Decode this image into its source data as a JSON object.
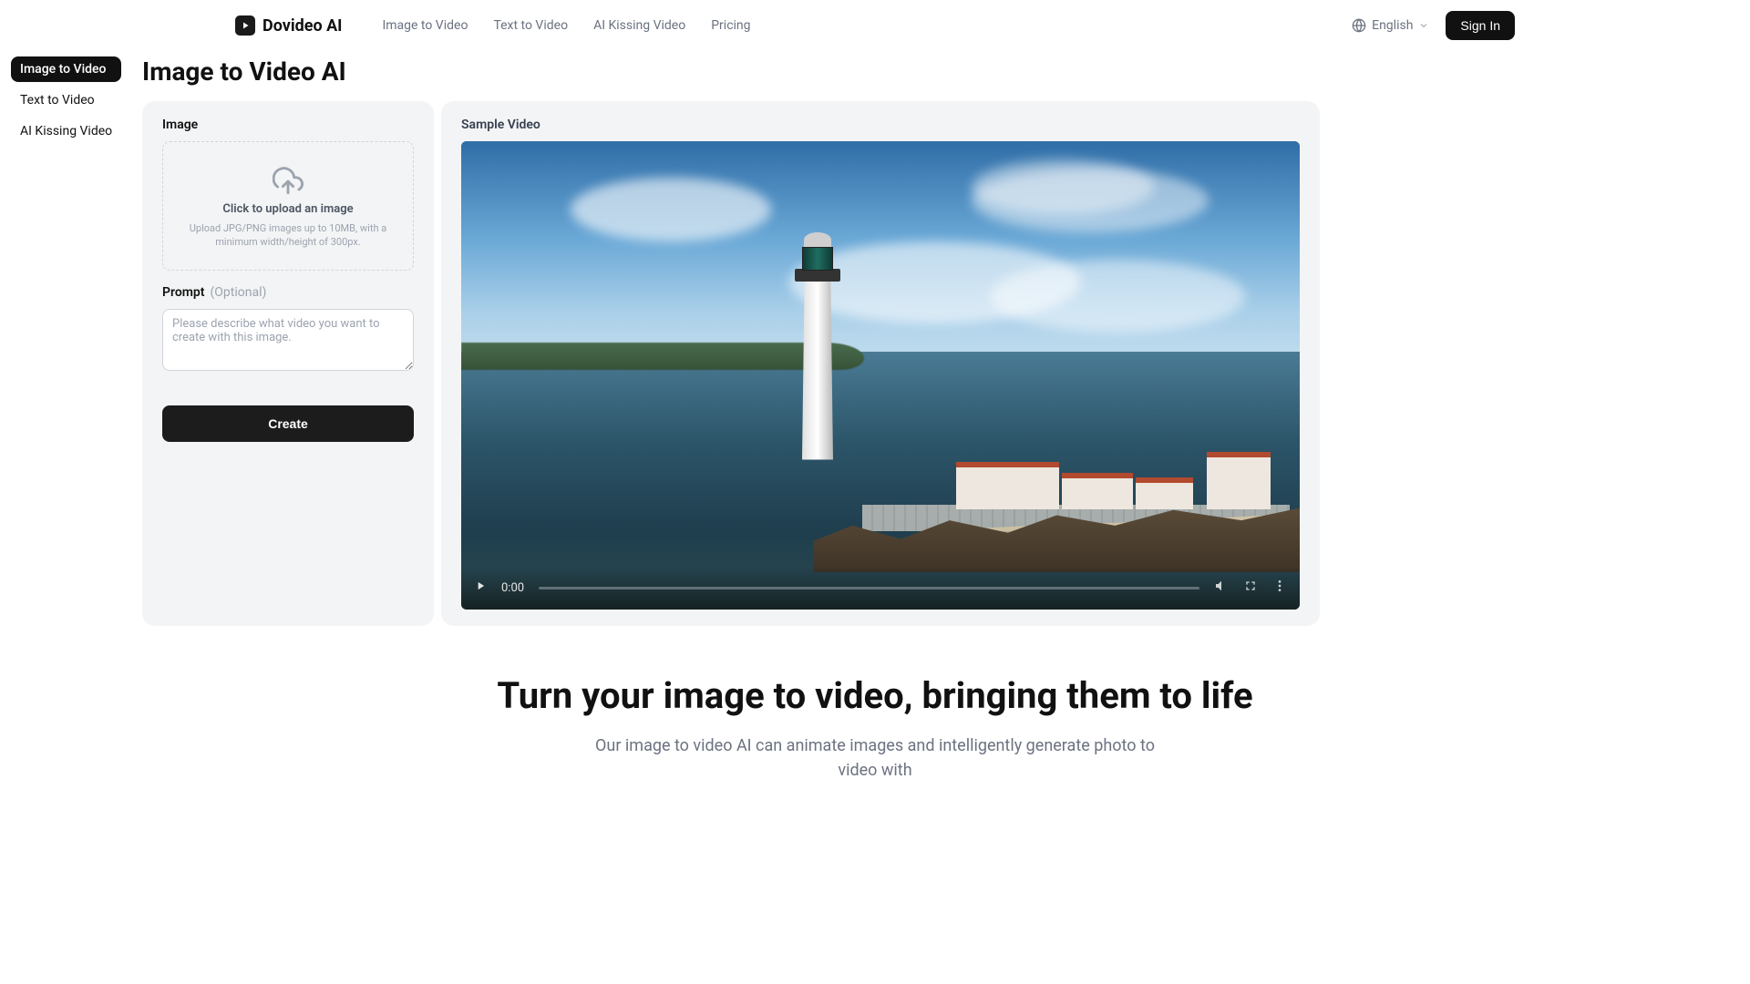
{
  "header": {
    "brand": "Dovideo AI",
    "nav": [
      {
        "label": "Image to Video"
      },
      {
        "label": "Text to Video"
      },
      {
        "label": "AI Kissing Video"
      },
      {
        "label": "Pricing"
      }
    ],
    "language": "English",
    "sign_in": "Sign In"
  },
  "sidebar": {
    "items": [
      {
        "label": "Image to Video",
        "active": true
      },
      {
        "label": "Text to Video",
        "active": false
      },
      {
        "label": "AI Kissing Video",
        "active": false
      }
    ]
  },
  "page_title": "Image to Video AI",
  "left_panel": {
    "image_label": "Image",
    "upload_title": "Click to upload an image",
    "upload_sub": "Upload JPG/PNG images up to 10MB, with a minimum width/height of 300px.",
    "prompt_label": "Prompt",
    "prompt_optional": "(Optional)",
    "prompt_placeholder": "Please describe what video you want to create with this image.",
    "create_label": "Create"
  },
  "right_panel": {
    "sample_label": "Sample Video",
    "time": "0:00"
  },
  "hero": {
    "title": "Turn your image to video, bringing them to life",
    "subtitle": "Our image to video AI can animate images and intelligently generate photo to video with"
  }
}
